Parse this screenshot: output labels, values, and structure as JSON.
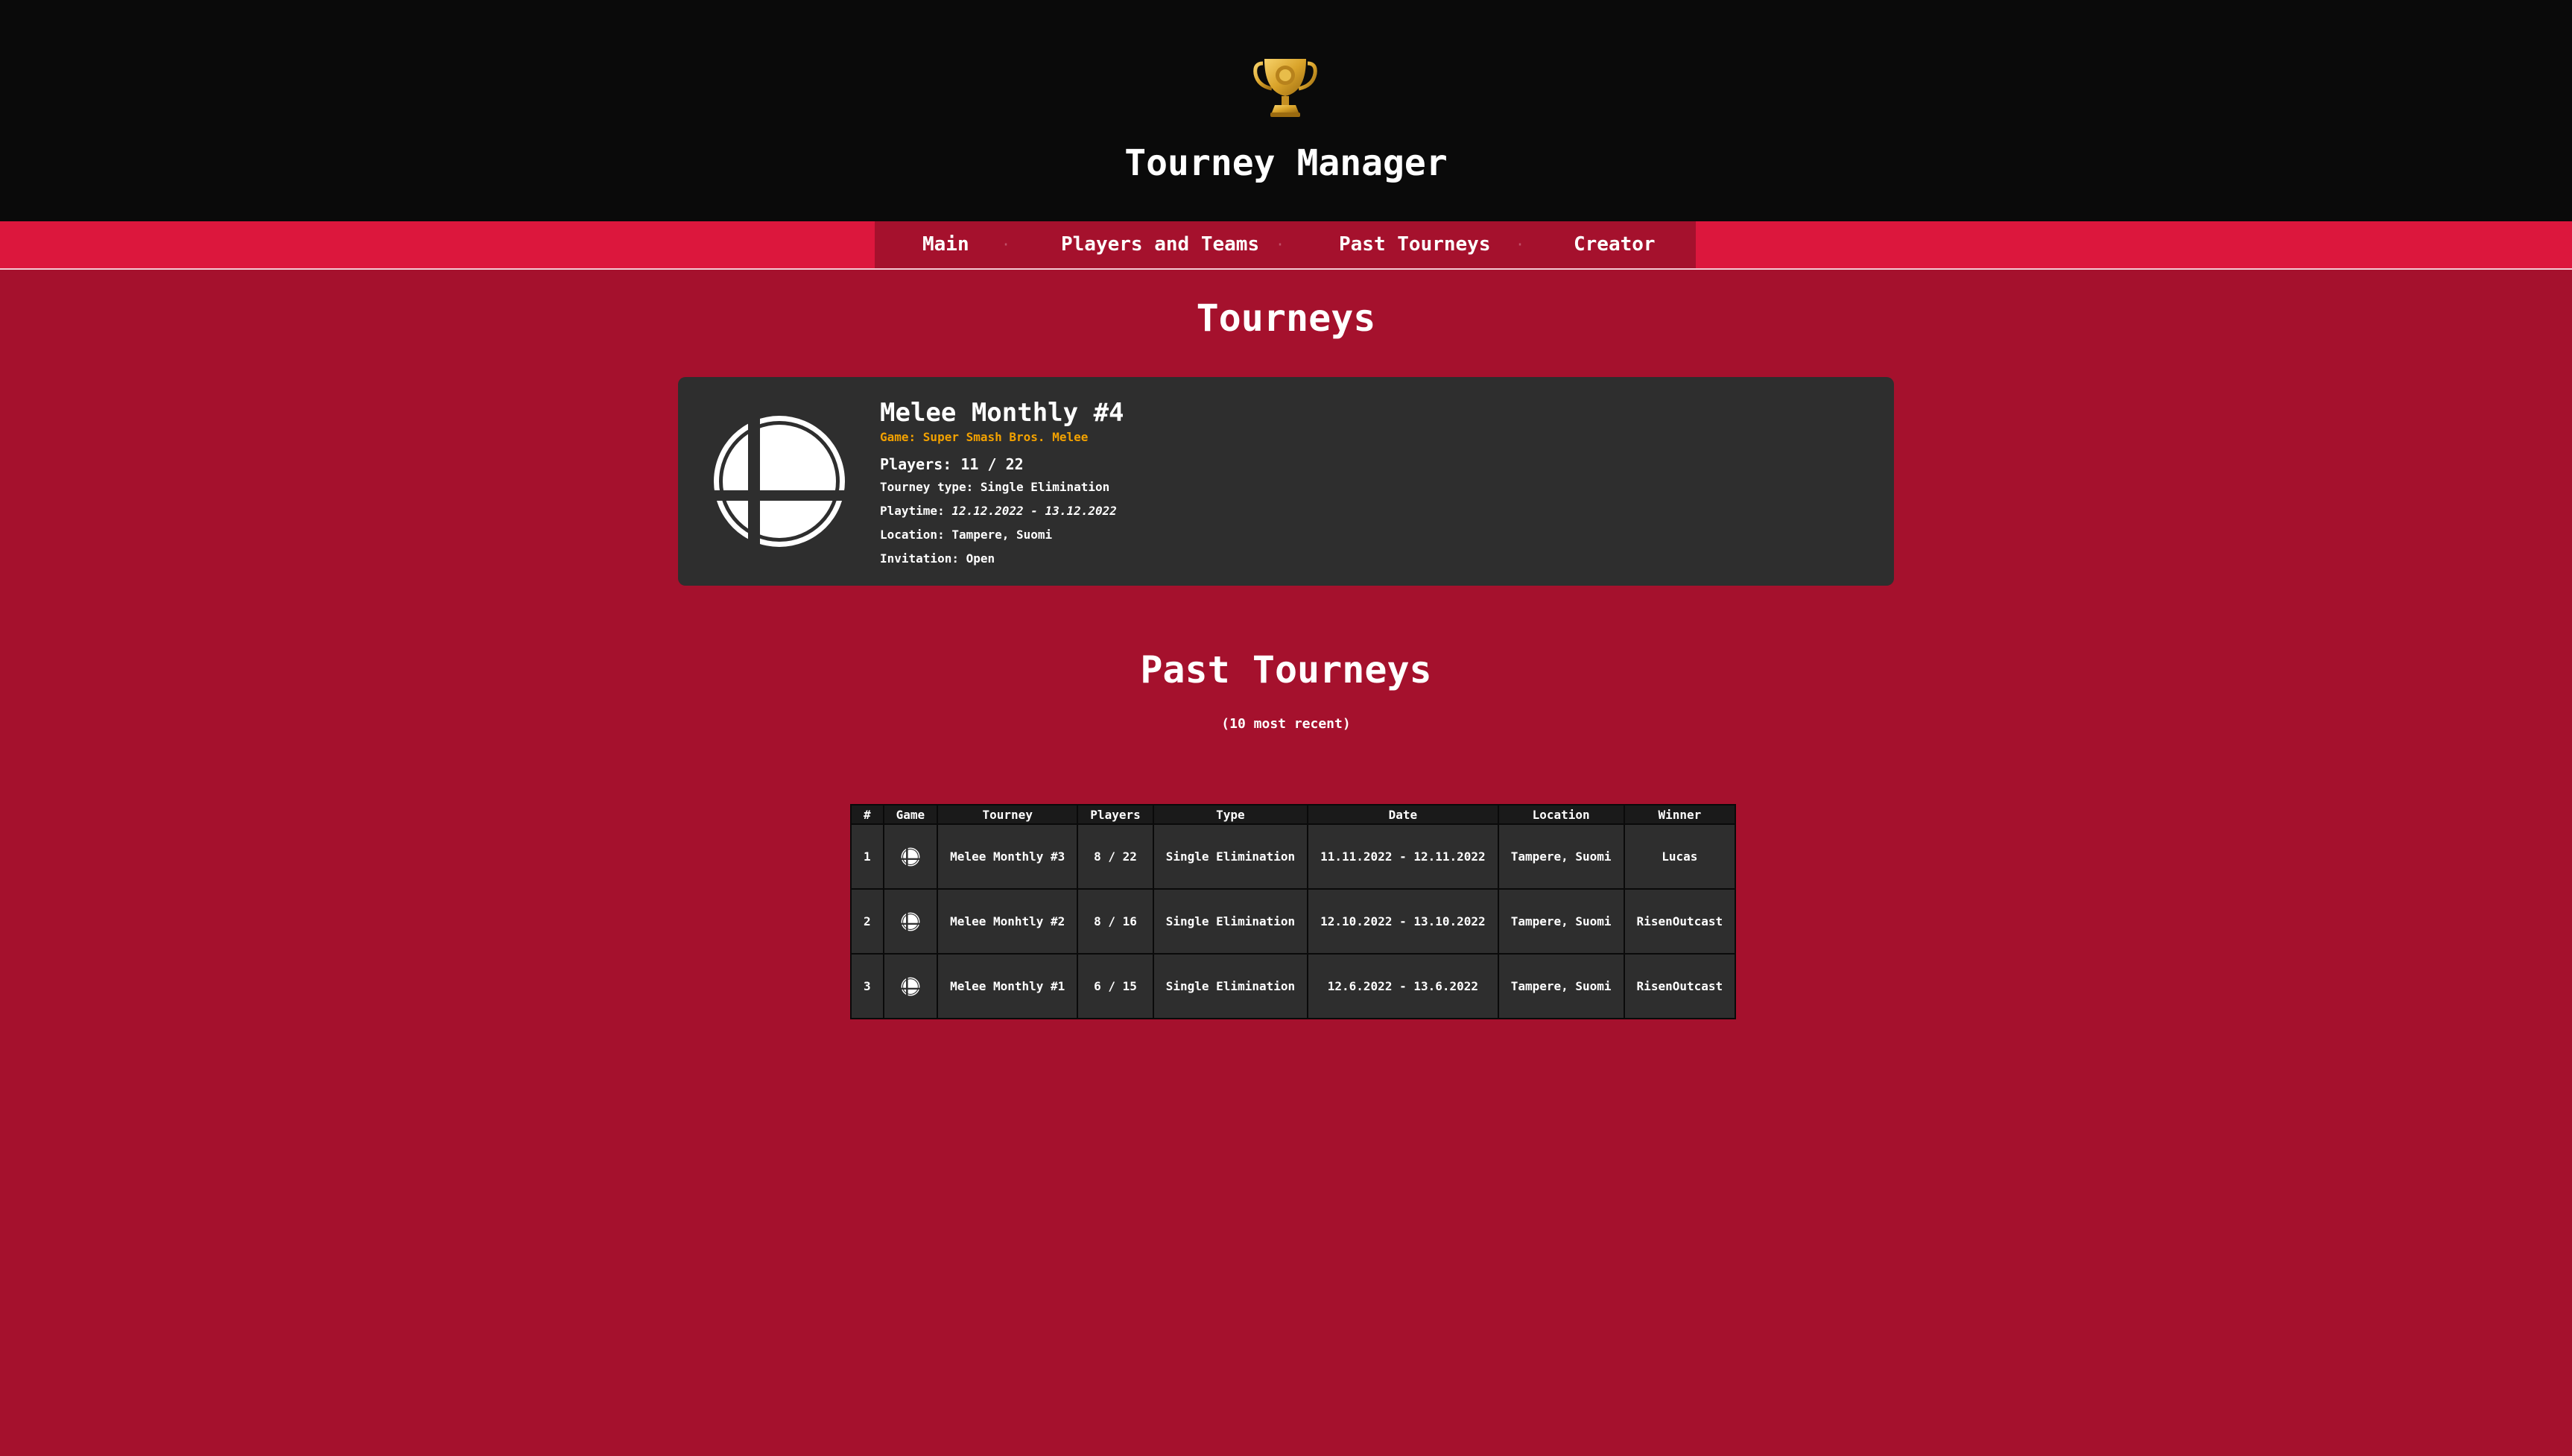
{
  "header": {
    "title": "Tourney Manager",
    "logo_icon": "trophy-icon"
  },
  "nav": {
    "items": [
      {
        "label": "Main"
      },
      {
        "label": "Players and Teams"
      },
      {
        "label": "Past Tourneys"
      },
      {
        "label": "Creator"
      }
    ],
    "separator": "·"
  },
  "current": {
    "section_title": "Tourneys",
    "tourney": {
      "name": "Melee Monthly #4",
      "game_line": "Game: Super Smash Bros. Melee",
      "players": "Players: 11 / 22",
      "type_label": "Tourney type: ",
      "type_value": "Single Elimination",
      "playtime_label": "Playtime: ",
      "playtime_value": "12.12.2022 - 13.12.2022",
      "location_label": "Location: ",
      "location_value": "Tampere, Suomi",
      "invitation_label": "Invitation: ",
      "invitation_value": "Open",
      "icon": "smash-bros-icon"
    }
  },
  "past": {
    "section_title": "Past Tourneys",
    "subtitle": "(10 most recent)",
    "columns": [
      "#",
      "Game",
      "Tourney",
      "Players",
      "Type",
      "Date",
      "Location",
      "Winner"
    ],
    "rows": [
      {
        "num": "1",
        "tourney": "Melee Monthly #3",
        "players": "8 / 22",
        "type": "Single Elimination",
        "date": "11.11.2022 - 12.11.2022",
        "location": "Tampere, Suomi",
        "winner": "Lucas"
      },
      {
        "num": "2",
        "tourney": "Melee Monhtly #2",
        "players": "8 / 16",
        "type": "Single Elimination",
        "date": "12.10.2022 - 13.10.2022",
        "location": "Tampere, Suomi",
        "winner": "RisenOutcast"
      },
      {
        "num": "3",
        "tourney": "Melee Monthly #1",
        "players": "6 / 15",
        "type": "Single Elimination",
        "date": "12.6.2022 - 13.6.2022",
        "location": "Tampere, Suomi",
        "winner": "RisenOutcast"
      }
    ]
  },
  "colors": {
    "page_bg": "#a5112d",
    "header_bg": "#0a0a0a",
    "nav_bar": "#dc173d",
    "card_bg": "#2e2e2e",
    "game_accent": "#f2a100"
  }
}
